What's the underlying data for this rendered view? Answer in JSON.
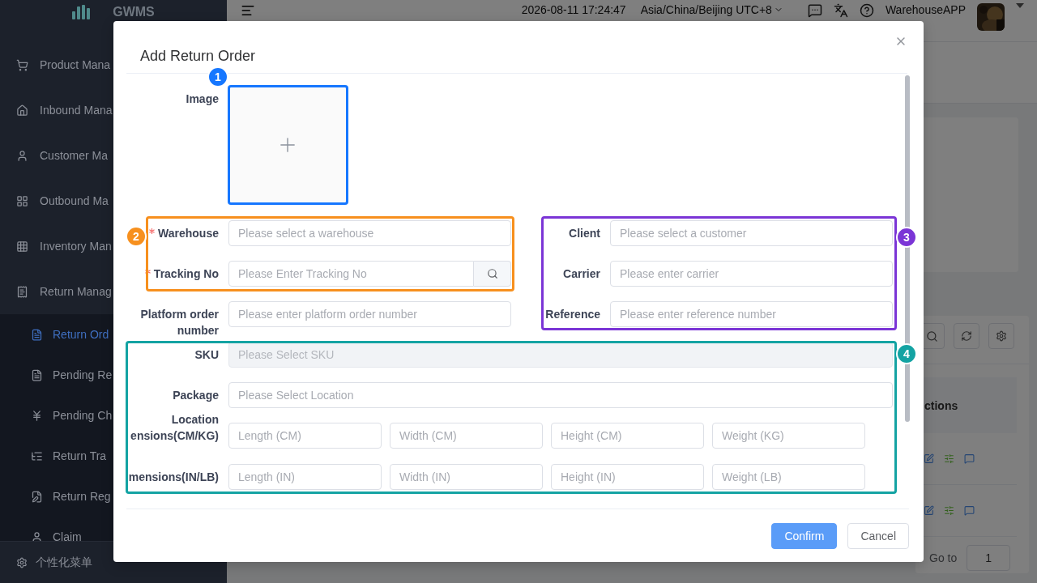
{
  "sidebar": {
    "logo": "GWMS",
    "items": [
      {
        "label": "Product Mana"
      },
      {
        "label": "Inbound Mana"
      },
      {
        "label": "Customer Ma"
      },
      {
        "label": "Outbound Ma"
      },
      {
        "label": "Inventory Man"
      },
      {
        "label": "Return Manag",
        "children": [
          {
            "label": "Return Ord",
            "selected": true
          },
          {
            "label": "Pending Re",
            "selected": false
          },
          {
            "label": "Pending Ch",
            "selected": false
          },
          {
            "label": "Return Tra",
            "selected": false
          },
          {
            "label": "Return Reg",
            "selected": false
          },
          {
            "label": "Claim",
            "selected": false
          }
        ]
      }
    ],
    "footer": "个性化菜单"
  },
  "header": {
    "datetime": "2026-08-11 17:24:47",
    "timezone": "Asia/China/Beijing UTC+8",
    "user": "WarehouseAPP"
  },
  "background": {
    "table_header": "ctions",
    "goto_label": "Go to",
    "page_input": "1"
  },
  "dialog": {
    "title": "Add Return Order",
    "image_label": "Image",
    "left_fields": [
      {
        "label": "Warehouse",
        "required": true,
        "kind": "text",
        "placeholder": "Please select a warehouse"
      },
      {
        "label": "Tracking No",
        "required": true,
        "kind": "search",
        "placeholder": "Please Enter Tracking No"
      },
      {
        "label": "Platform order\nnumber",
        "required": false,
        "kind": "text",
        "placeholder": "Please enter platform order number"
      }
    ],
    "right_fields": [
      {
        "label": "Client",
        "required": false,
        "kind": "text",
        "placeholder": "Please select a customer"
      },
      {
        "label": "Carrier",
        "required": false,
        "kind": "text",
        "placeholder": "Please enter carrier"
      },
      {
        "label": "Reference",
        "required": false,
        "kind": "text",
        "placeholder": "Please enter reference number"
      }
    ],
    "wide_fields": [
      {
        "label": "SKU",
        "disabled": true,
        "placeholder": "Please Select SKU"
      },
      {
        "label": "Package",
        "disabled": false,
        "placeholder": "Please Select Location"
      }
    ],
    "dimension_rows": [
      {
        "label": "Location\nensions(CM/KG)",
        "placeholders": [
          "Length (CM)",
          "Width (CM)",
          "Height (CM)",
          "Weight (KG)"
        ]
      },
      {
        "label": "mensions(IN/LB)",
        "placeholders": [
          "Length (IN)",
          "Width (IN)",
          "Height (IN)",
          "Weight (LB)"
        ]
      }
    ],
    "buttons": [
      {
        "label": "Confirm",
        "kind": "primary"
      },
      {
        "label": "Cancel",
        "kind": "default"
      }
    ]
  },
  "annotations": [
    {
      "number": "1",
      "color": "#1677ff"
    },
    {
      "number": "2",
      "color": "#f7901e"
    },
    {
      "number": "3",
      "color": "#7b35d6"
    },
    {
      "number": "4",
      "color": "#14a3a3"
    }
  ]
}
